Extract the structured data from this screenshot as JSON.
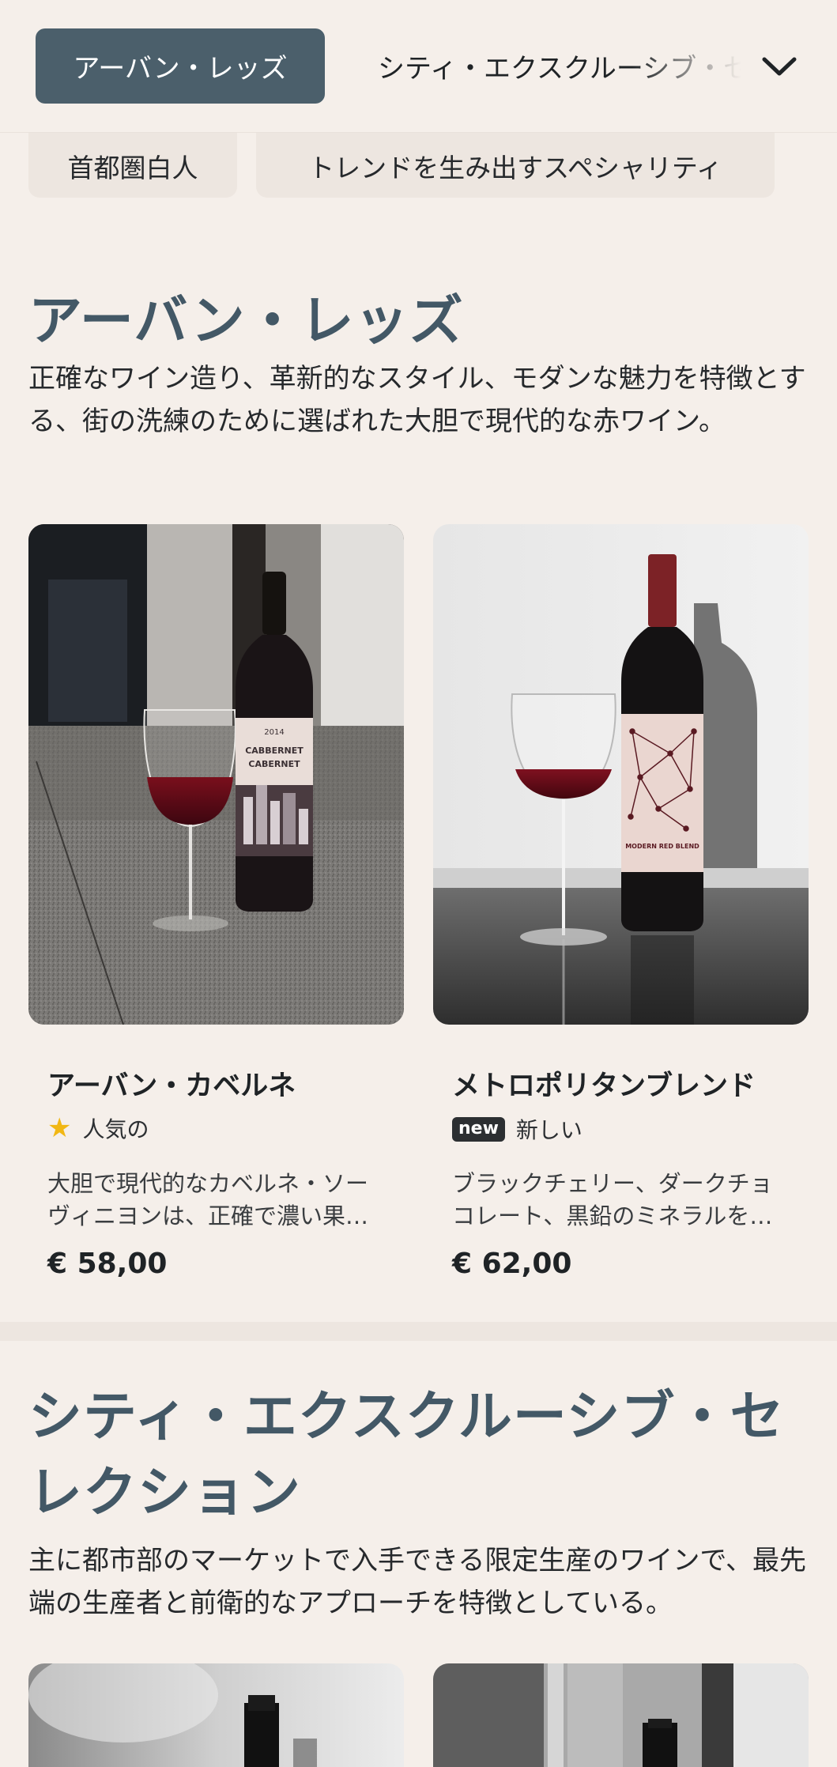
{
  "tabs": {
    "active": "アーバン・レッズ",
    "next": "シティ・エクスクルーシブ・セレクション"
  },
  "chips": [
    "首都圏白人",
    "トレンドを生み出すスペシャリティ"
  ],
  "section1": {
    "title": "アーバン・レッズ",
    "description": "正確なワイン造り、革新的なスタイル、モダンな魅力を特徴とする、街の洗練のために選ばれた大胆で現代的な赤ワイン。",
    "products": [
      {
        "name": "アーバン・カベルネ",
        "badge_icon": "star-icon",
        "badge_text": "人気の",
        "description": "大胆で現代的なカベルネ・ソーヴィニヨンは、正確で濃い果…",
        "price": "€ 58,00"
      },
      {
        "name": "メトロポリタンブレンド",
        "badge_icon": "new-badge",
        "badge_label": "new",
        "badge_text": "新しい",
        "description": "ブラックチェリー、ダークチョコレート、黒鉛のミネラルを…",
        "price": "€ 62,00"
      }
    ]
  },
  "section2": {
    "title": "シティ・エクスクルーシブ・セレクション",
    "description": "主に都市部のマーケットで入手できる限定生産のワインで、最先端の生産者と前衛的なアプローチを特徴としている。"
  },
  "label_text": {
    "bottle1_year": "2014",
    "bottle1_line1": "CABBERNET",
    "bottle1_line2": "CABERNET",
    "bottle2_line": "MODERN RED BLEND"
  },
  "colors": {
    "background": "#f5efea",
    "accent": "#4b5f6b",
    "heading": "#435866",
    "star": "#f1b714"
  }
}
